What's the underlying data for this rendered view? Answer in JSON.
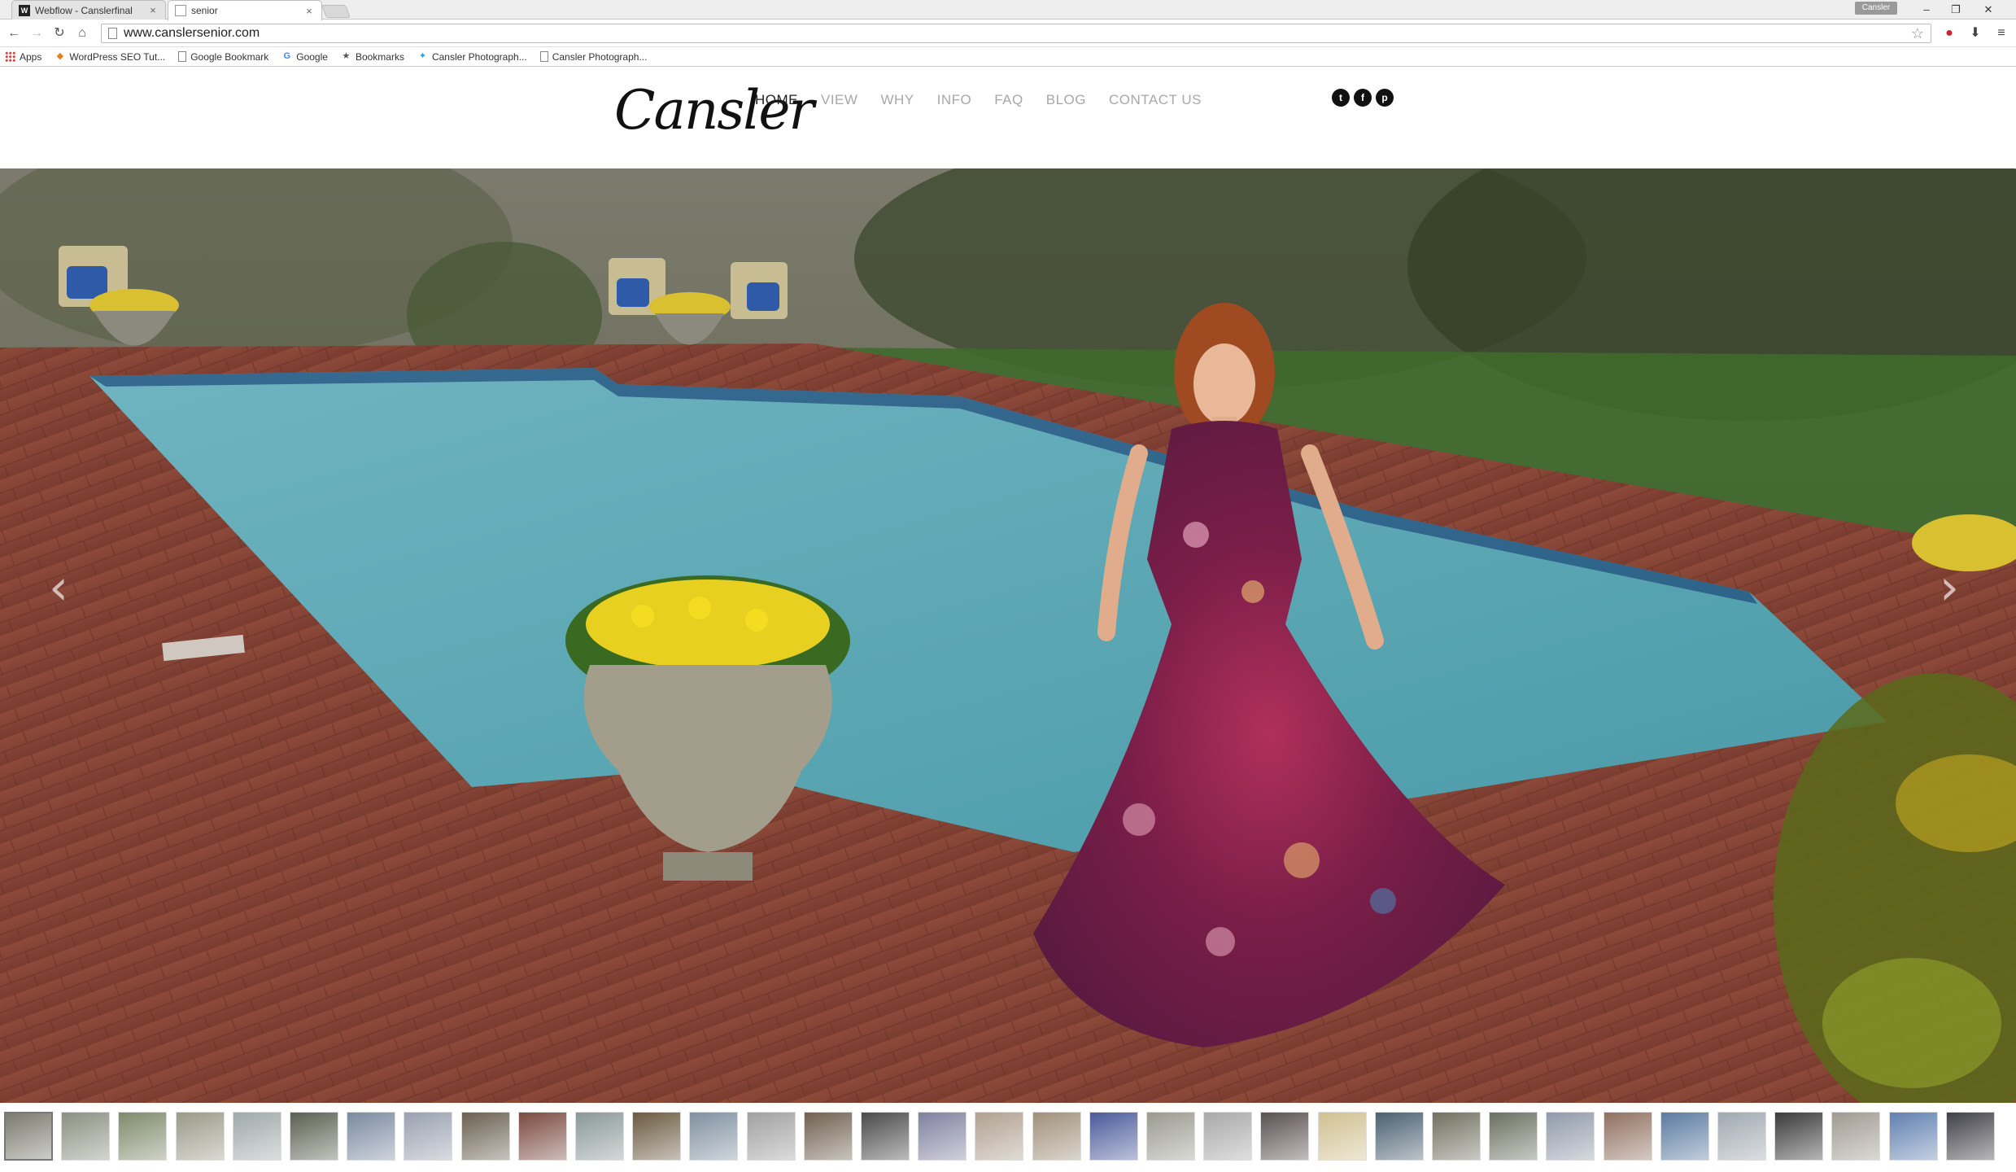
{
  "browser": {
    "tabs": [
      {
        "title": "Webflow - Canslerfinal",
        "favicon": "W",
        "active": false
      },
      {
        "title": "senior",
        "favicon": "",
        "active": true
      }
    ],
    "profile": "Cansler",
    "url": "www.canslersenior.com",
    "bookmarks": [
      {
        "label": "Apps",
        "icon": "apps-grid-icon"
      },
      {
        "label": "WordPress SEO Tut...",
        "icon": "bookmark-favicon"
      },
      {
        "label": "Google Bookmark",
        "icon": "page-icon"
      },
      {
        "label": "Google",
        "icon": "google-icon"
      },
      {
        "label": "Bookmarks",
        "icon": "star-icon"
      },
      {
        "label": "Cansler Photograph...",
        "icon": "twitter-icon"
      },
      {
        "label": "Cansler Photograph...",
        "icon": "page-icon"
      }
    ]
  },
  "site": {
    "logo": "Cansler",
    "nav": [
      "HOME",
      "VIEW",
      "WHY",
      "INFO",
      "FAQ",
      "BLOG",
      "CONTACT US"
    ],
    "active_nav": "HOME",
    "social": [
      {
        "name": "twitter-icon",
        "glyph": "t"
      },
      {
        "name": "facebook-icon",
        "glyph": "f"
      },
      {
        "name": "pinterest-icon",
        "glyph": "p"
      }
    ]
  },
  "slideshow": {
    "prev_glyph": "‹",
    "next_glyph": "›",
    "thumbnail_count": 35,
    "active_thumbnail": 1,
    "thumb_colors": [
      "#7a7a6e",
      "#8a9080",
      "#7d8a6a",
      "#9a9a88",
      "#a0a8a8",
      "#5a6050",
      "#7a8aa0",
      "#9aa0b0",
      "#6a6050",
      "#7a4a40",
      "#8a9898",
      "#6a5a40",
      "#8090a0",
      "#a0a0a0",
      "#706050",
      "#4a4a4a",
      "#8080a0",
      "#b0a090",
      "#a0907a",
      "#4a5a9a",
      "#9a9a90",
      "#a8a8a8",
      "#5a5050",
      "#d0c090",
      "#4a6070",
      "#707060",
      "#6a7060",
      "#909aaa",
      "#907060",
      "#5a7aa0",
      "#a0a8b0",
      "#3a3a3a",
      "#a09a90",
      "#6080b0",
      "#404048"
    ]
  }
}
